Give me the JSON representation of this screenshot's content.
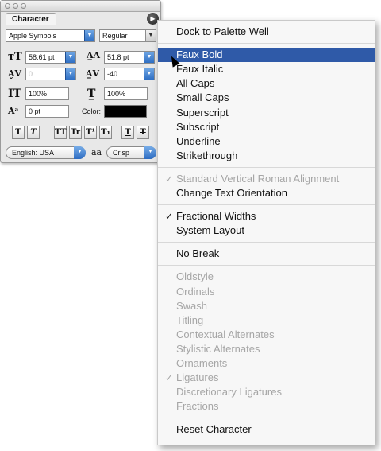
{
  "palette": {
    "title": "Character",
    "font_family": "Apple Symbols",
    "font_style": "Regular",
    "font_size": "58.61 pt",
    "leading": "51.8 pt",
    "kerning": "0",
    "tracking": "-40",
    "vertical_scale": "100%",
    "horizontal_scale": "100%",
    "baseline_shift": "0 pt",
    "color_label": "Color:",
    "color_value": "#000000",
    "style_buttons": [
      "T",
      "T",
      "TT",
      "Tr",
      "T¹",
      "T₁",
      "T",
      "T"
    ],
    "language": "English: USA",
    "aa_glyph": "aa",
    "anti_alias": "Crisp"
  },
  "menu": {
    "groups": [
      [
        {
          "label": "Dock to Palette Well",
          "enabled": true
        }
      ],
      [
        {
          "label": "Faux Bold",
          "enabled": true,
          "selected": true
        },
        {
          "label": "Faux Italic",
          "enabled": true
        },
        {
          "label": "All Caps",
          "enabled": true
        },
        {
          "label": "Small Caps",
          "enabled": true
        },
        {
          "label": "Superscript",
          "enabled": true
        },
        {
          "label": "Subscript",
          "enabled": true
        },
        {
          "label": "Underline",
          "enabled": true
        },
        {
          "label": "Strikethrough",
          "enabled": true
        }
      ],
      [
        {
          "label": "Standard Vertical Roman Alignment",
          "enabled": false,
          "checked": true
        },
        {
          "label": "Change Text Orientation",
          "enabled": true
        }
      ],
      [
        {
          "label": "Fractional Widths",
          "enabled": true,
          "checked": true
        },
        {
          "label": "System Layout",
          "enabled": true
        }
      ],
      [
        {
          "label": "No Break",
          "enabled": true
        }
      ],
      [
        {
          "label": "Oldstyle",
          "enabled": false
        },
        {
          "label": "Ordinals",
          "enabled": false
        },
        {
          "label": "Swash",
          "enabled": false
        },
        {
          "label": "Titling",
          "enabled": false
        },
        {
          "label": "Contextual Alternates",
          "enabled": false
        },
        {
          "label": "Stylistic Alternates",
          "enabled": false
        },
        {
          "label": "Ornaments",
          "enabled": false
        },
        {
          "label": "Ligatures",
          "enabled": false,
          "checked": true
        },
        {
          "label": "Discretionary Ligatures",
          "enabled": false
        },
        {
          "label": "Fractions",
          "enabled": false
        }
      ],
      [
        {
          "label": "Reset Character",
          "enabled": true
        }
      ]
    ],
    "check_glyph": "✓",
    "highlight_color": "#2f5aa8"
  }
}
